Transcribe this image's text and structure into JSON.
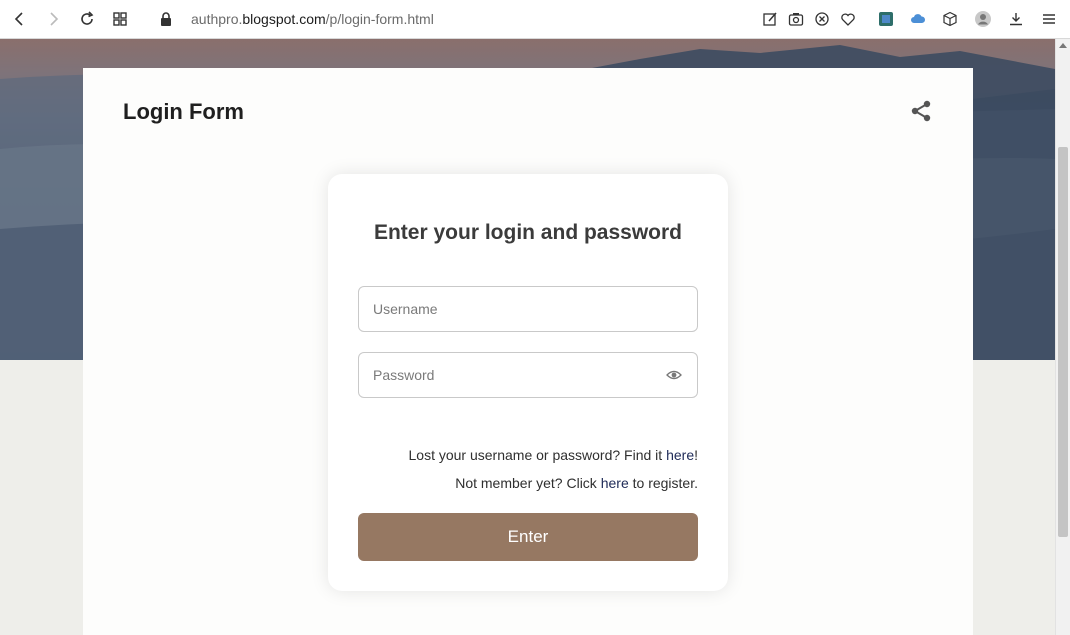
{
  "browser": {
    "url_prefix": "authpro.",
    "url_domain": "blogspot.com",
    "url_path": "/p/login-form.html"
  },
  "page": {
    "title": "Login Form"
  },
  "form": {
    "heading": "Enter your login and password",
    "username_placeholder": "Username",
    "password_placeholder": "Password",
    "lost_text": "Lost your username or password? Find it ",
    "lost_link": "here",
    "lost_suffix": "!",
    "register_text": "Not member yet? Click ",
    "register_link": "here",
    "register_suffix": " to register.",
    "submit_label": "Enter"
  },
  "colors": {
    "button": "#967862",
    "link": "#1e2a57"
  }
}
